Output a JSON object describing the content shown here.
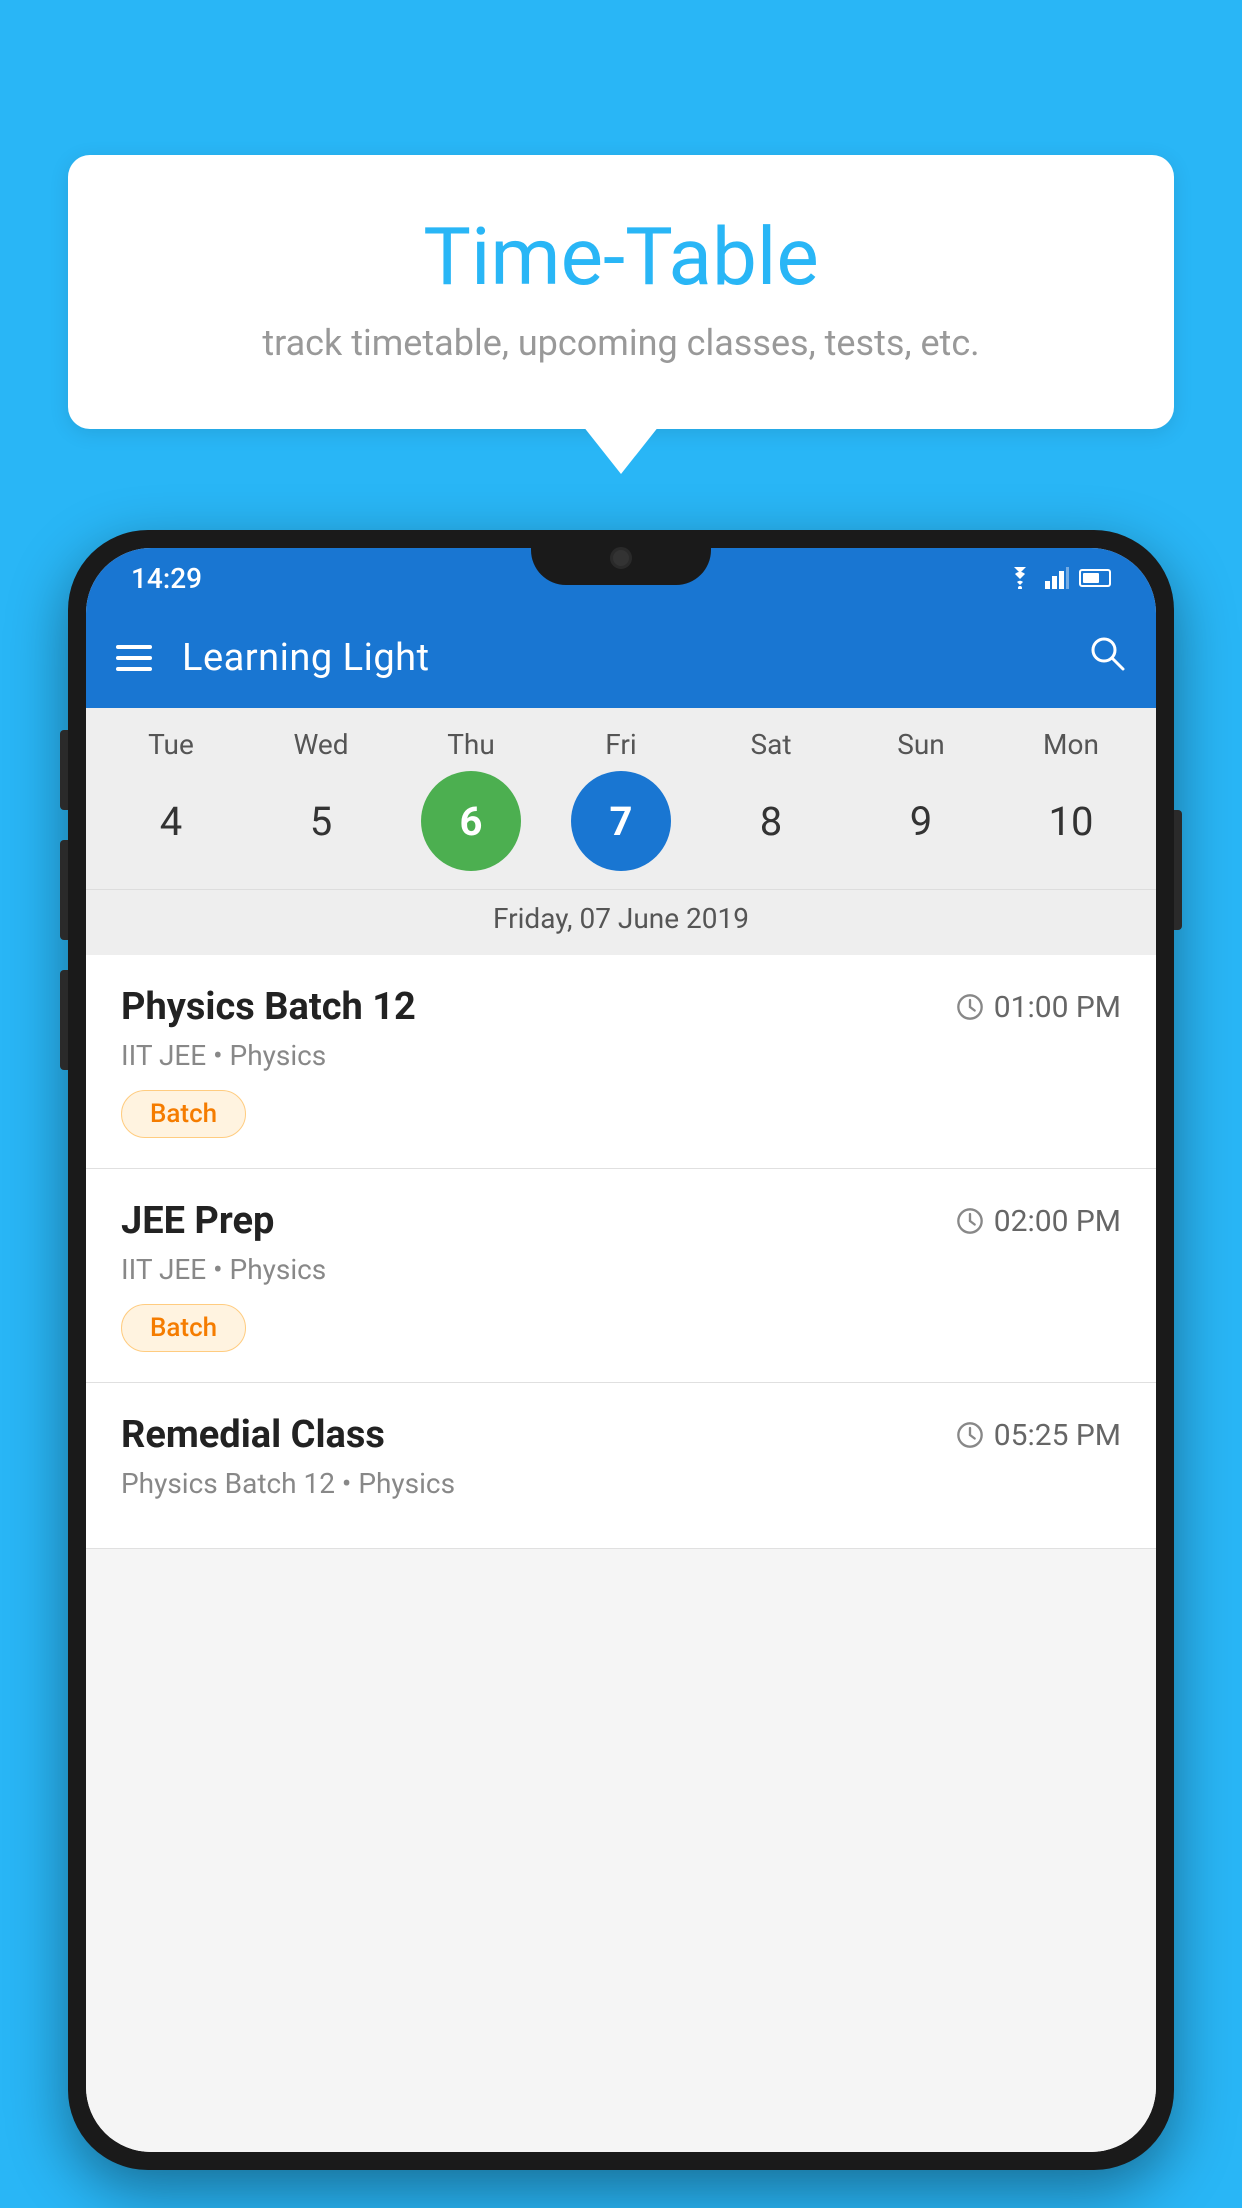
{
  "background_color": "#29B6F6",
  "bubble": {
    "title": "Time-Table",
    "subtitle": "track timetable, upcoming classes, tests, etc."
  },
  "phone": {
    "status_bar": {
      "time": "14:29"
    },
    "app_bar": {
      "title": "Learning Light"
    },
    "calendar": {
      "days": [
        "Tue",
        "Wed",
        "Thu",
        "Fri",
        "Sat",
        "Sun",
        "Mon"
      ],
      "dates": [
        "4",
        "5",
        "6",
        "7",
        "8",
        "9",
        "10"
      ],
      "today_index": 2,
      "selected_index": 3,
      "selected_label": "Friday, 07 June 2019"
    },
    "schedule": [
      {
        "title": "Physics Batch 12",
        "time": "01:00 PM",
        "sub": "IIT JEE • Physics",
        "badge": "Batch"
      },
      {
        "title": "JEE Prep",
        "time": "02:00 PM",
        "sub": "IIT JEE • Physics",
        "badge": "Batch"
      },
      {
        "title": "Remedial Class",
        "time": "05:25 PM",
        "sub": "Physics Batch 12 • Physics",
        "badge": ""
      }
    ]
  }
}
